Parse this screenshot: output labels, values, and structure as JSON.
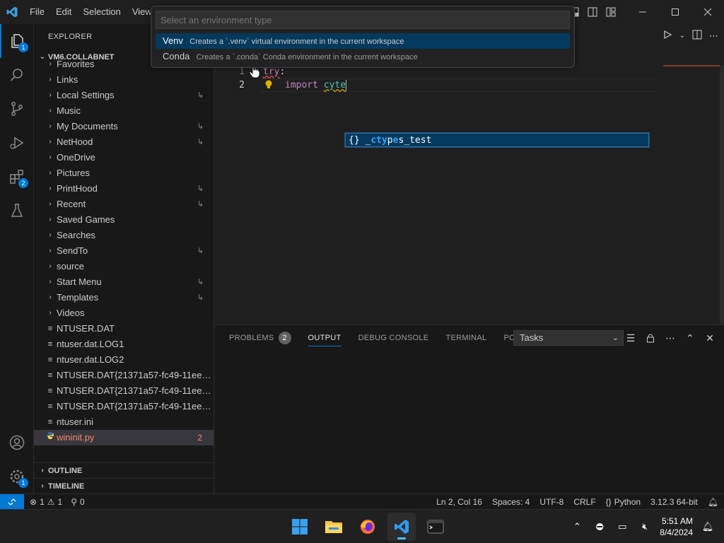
{
  "colors": {
    "accent": "#0078d4",
    "error": "#f48771",
    "keyword": "#c586c0",
    "type": "#4ec9b0",
    "selection": "#04395e"
  },
  "menu": [
    "File",
    "Edit",
    "Selection",
    "View"
  ],
  "quickpick": {
    "placeholder": "Select an environment type",
    "items": [
      {
        "label": "Venv",
        "description": "Creates a `.venv` virtual environment in the current workspace"
      },
      {
        "label": "Conda",
        "description": "Creates a `.conda` Conda environment in the current workspace"
      }
    ]
  },
  "activitybar": {
    "explorer_badge": "1",
    "extensions_badge": "2",
    "manage_badge": "1"
  },
  "sidebar": {
    "title": "EXPLORER",
    "root": "VM6.COLLABNET",
    "items": [
      {
        "label": "Favorites",
        "type": "folder",
        "link": false
      },
      {
        "label": "Links",
        "type": "folder",
        "link": false
      },
      {
        "label": "Local Settings",
        "type": "folder",
        "link": true
      },
      {
        "label": "Music",
        "type": "folder",
        "link": false
      },
      {
        "label": "My Documents",
        "type": "folder",
        "link": true
      },
      {
        "label": "NetHood",
        "type": "folder",
        "link": true
      },
      {
        "label": "OneDrive",
        "type": "folder",
        "link": false
      },
      {
        "label": "Pictures",
        "type": "folder",
        "link": false
      },
      {
        "label": "PrintHood",
        "type": "folder",
        "link": true
      },
      {
        "label": "Recent",
        "type": "folder",
        "link": true
      },
      {
        "label": "Saved Games",
        "type": "folder",
        "link": false
      },
      {
        "label": "Searches",
        "type": "folder",
        "link": false
      },
      {
        "label": "SendTo",
        "type": "folder",
        "link": true
      },
      {
        "label": "source",
        "type": "folder",
        "link": false
      },
      {
        "label": "Start Menu",
        "type": "folder",
        "link": true
      },
      {
        "label": "Templates",
        "type": "folder",
        "link": true
      },
      {
        "label": "Videos",
        "type": "folder",
        "link": false
      },
      {
        "label": "NTUSER.DAT",
        "type": "file",
        "link": false
      },
      {
        "label": "ntuser.dat.LOG1",
        "type": "file",
        "link": false
      },
      {
        "label": "ntuser.dat.LOG2",
        "type": "file",
        "link": false
      },
      {
        "label": "NTUSER.DAT{21371a57-fc49-11ee-a...",
        "type": "file",
        "link": false
      },
      {
        "label": "NTUSER.DAT{21371a57-fc49-11ee-a...",
        "type": "file",
        "link": false
      },
      {
        "label": "NTUSER.DAT{21371a57-fc49-11ee-a...",
        "type": "file",
        "link": false
      },
      {
        "label": "ntuser.ini",
        "type": "file",
        "link": false
      },
      {
        "label": "wininit.py",
        "type": "python",
        "link": false,
        "selected": true,
        "errors": "2"
      }
    ],
    "outline": "OUTLINE",
    "timeline": "TIMELINE"
  },
  "editor": {
    "lines": [
      {
        "num": "1",
        "keyword": "try",
        "rest": ":"
      },
      {
        "num": "2",
        "keyword": "import",
        "rest": "cyte"
      }
    ],
    "suggestion": {
      "icon": "{}",
      "prefix": "_",
      "m1": "cty",
      "mid": "p",
      "m2": "e",
      "suffix": "s_test"
    }
  },
  "panel": {
    "tabs": [
      {
        "label": "PROBLEMS",
        "badge": "2"
      },
      {
        "label": "OUTPUT",
        "active": true
      },
      {
        "label": "DEBUG CONSOLE"
      },
      {
        "label": "TERMINAL"
      },
      {
        "label": "PORTS"
      }
    ],
    "task_select": "Tasks"
  },
  "statusbar": {
    "errors": "1",
    "warnings": "1",
    "ports": "0",
    "position": "Ln 2, Col 16",
    "spaces": "Spaces: 4",
    "encoding": "UTF-8",
    "eol": "CRLF",
    "language": "Python",
    "interpreter": "3.12.3 64-bit"
  },
  "taskbar": {
    "time": "5:51 AM",
    "date": "8/4/2024"
  }
}
